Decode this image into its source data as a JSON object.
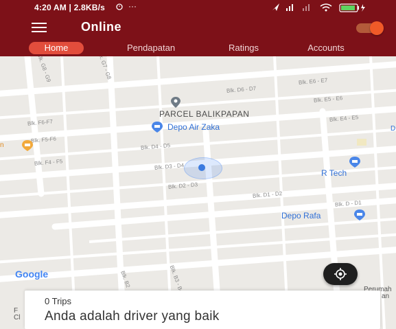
{
  "status_bar": {
    "time_speed": "4:20 AM | 2.8KB/s",
    "more": "···"
  },
  "app_bar": {
    "title": "Online"
  },
  "tabs": [
    {
      "label": "Home",
      "active": true
    },
    {
      "label": "Pendapatan",
      "active": false
    },
    {
      "label": "Ratings",
      "active": false
    },
    {
      "label": "Accounts",
      "active": false
    }
  ],
  "map": {
    "pois": {
      "parcel": "PARCEL BALIKPAPAN",
      "depo_air": "Depo Air Zaka",
      "r_tech": "R Tech",
      "depo_rafa": "Depo Rafa"
    },
    "blocks": {
      "b1": "Blk. G8 - G9",
      "b2": "Blk. G7 - G8",
      "b3": "Blk. D6 - D7",
      "b4": "Blk. E6 - E7",
      "b5": "Blk. E5 - E6",
      "b6": "Blk. F6-F7",
      "b7": "Blk. E4 - E5",
      "b8": "Blk. F5-F6",
      "b9": "Blk. D4 - D5",
      "b10": "Blk. F4 - F5",
      "b11": "Blk. D3 - D4",
      "b12": "Blk. D2 - D3",
      "b13": "Blk. D1 - D2",
      "b14": "Blk. D - D1",
      "b15": "Blk. B2",
      "b16": "Blk. B3 - B4"
    },
    "edge_text": {
      "left_n": "n",
      "right_d": "D",
      "left_f": "F",
      "left_c": "Cl",
      "perumah": "Perumah",
      "an": "an"
    },
    "google_logo": "Google",
    "colors": {
      "brand": "#7d1118",
      "tab_active": "#e24d3c",
      "poi_blue": "#2f6fd6",
      "accent_orange": "#f05a28"
    }
  },
  "card": {
    "trips": "0 Trips",
    "message": "Anda adalah driver yang baik"
  }
}
